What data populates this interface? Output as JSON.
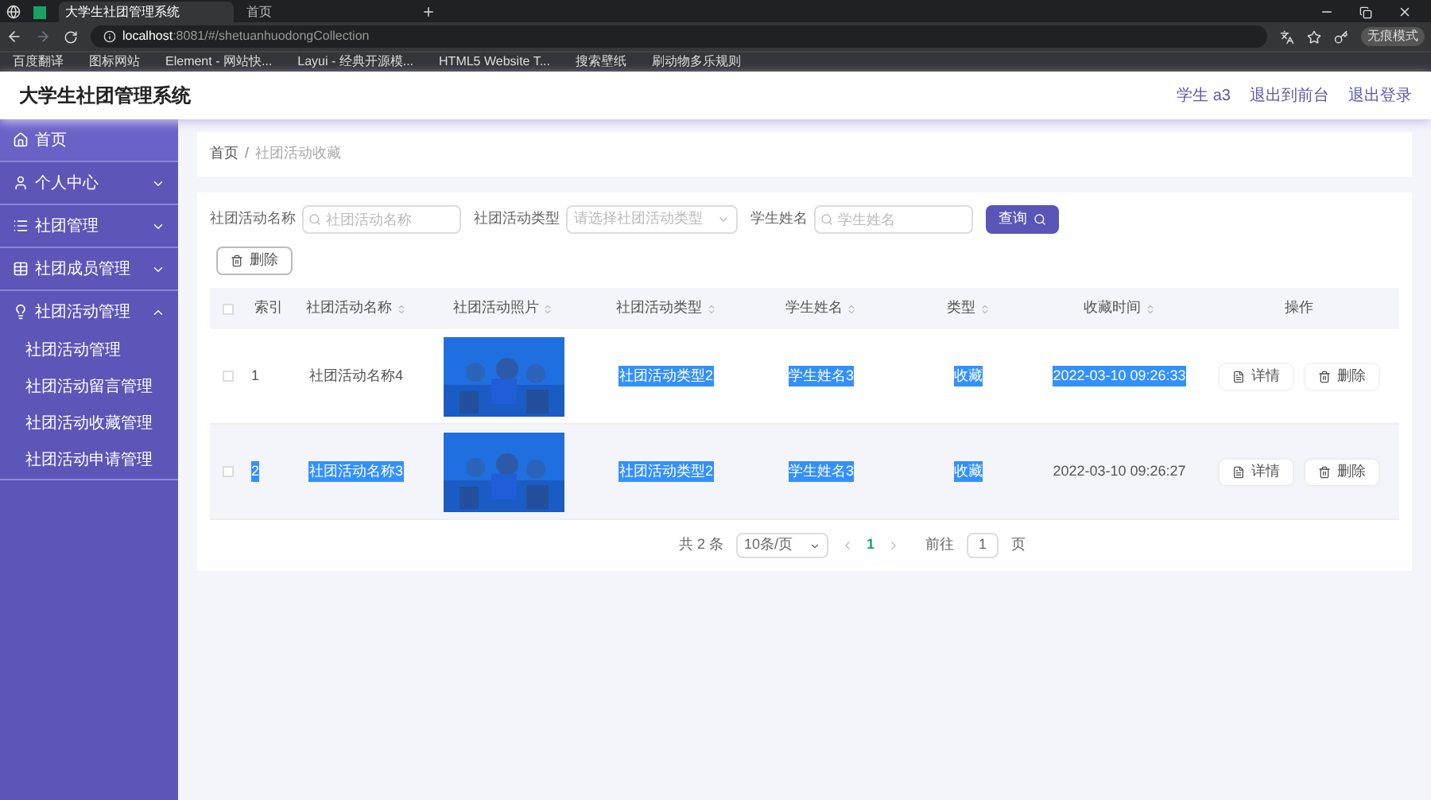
{
  "browser": {
    "tabs": [
      {
        "label": "大学生社团管理系统",
        "selected": true
      },
      {
        "label": "首页",
        "selected": false
      }
    ],
    "url": {
      "host": "localhost",
      "rest": ":8081/#/shetuanhuodongCollection"
    },
    "profile": "无痕模式",
    "bookmarks": [
      "百度翻译",
      "图标网站",
      "Element - 网站快...",
      "Layui - 经典开源模...",
      "HTML5 Website T...",
      "搜索壁纸",
      "刷动物多乐规则"
    ]
  },
  "header": {
    "title": "大学生社团管理系统",
    "links": [
      "学生 a3",
      "退出到前台",
      "退出登录"
    ]
  },
  "sidebar": {
    "items": [
      {
        "label": "首页",
        "kind": "home",
        "expandable": false,
        "expanded": false
      },
      {
        "label": "个人中心",
        "kind": "user",
        "expandable": true,
        "expanded": false
      },
      {
        "label": "社团管理",
        "kind": "list",
        "expandable": true,
        "expanded": false
      },
      {
        "label": "社团成员管理",
        "kind": "table",
        "expandable": true,
        "expanded": false
      },
      {
        "label": "社团活动管理",
        "kind": "bulb",
        "expandable": true,
        "expanded": true,
        "children": [
          {
            "label": "社团活动管理"
          },
          {
            "label": "社团活动留言管理"
          },
          {
            "label": "社团活动收藏管理"
          },
          {
            "label": "社团活动申请管理"
          }
        ]
      }
    ]
  },
  "breadcrumb": {
    "items": [
      "首页",
      "社团活动收藏"
    ],
    "separator": "/"
  },
  "filters": [
    {
      "kind": "input",
      "label": "社团活动名称",
      "placeholder": "社团活动名称"
    },
    {
      "kind": "select",
      "label": "社团活动类型",
      "placeholder": "请选择社团活动类型"
    },
    {
      "kind": "input",
      "label": "学生姓名",
      "placeholder": "学生姓名"
    }
  ],
  "search_button": "查询",
  "delete_button": "删除",
  "table": {
    "all_checked": false,
    "columns": [
      {
        "label": "索引",
        "sortable": false
      },
      {
        "label": "社团活动名称",
        "sortable": true
      },
      {
        "label": "社团活动照片",
        "sortable": true
      },
      {
        "label": "社团活动类型",
        "sortable": true
      },
      {
        "label": "学生姓名",
        "sortable": true
      },
      {
        "label": "类型",
        "sortable": true
      },
      {
        "label": "收藏时间",
        "sortable": true
      },
      {
        "label": "操作",
        "sortable": false
      }
    ],
    "rows": [
      {
        "checked": false,
        "cells": [
          {
            "text": "1",
            "highlighted": false
          },
          {
            "text": "社团活动名称4",
            "highlighted": false
          },
          {
            "kind": "picture"
          },
          {
            "text": "社团活动类型2",
            "highlighted": true
          },
          {
            "text": "学生姓名3",
            "highlighted": true
          },
          {
            "text": "收藏",
            "highlighted": true
          },
          {
            "text": "2022-03-10 09:26:33",
            "highlighted": true
          }
        ],
        "actions": [
          "详情",
          "删除"
        ]
      },
      {
        "checked": false,
        "cells": [
          {
            "text": "2",
            "highlighted": true
          },
          {
            "text": "社团活动名称3",
            "highlighted": true
          },
          {
            "kind": "picture"
          },
          {
            "text": "社团活动类型2",
            "highlighted": true
          },
          {
            "text": "学生姓名3",
            "highlighted": true
          },
          {
            "text": "收藏",
            "highlighted": true
          },
          {
            "text": "2022-03-10 09:26:27",
            "highlighted": false
          }
        ],
        "actions": [
          "详情",
          "删除"
        ]
      }
    ]
  },
  "pagination": {
    "total": "共 2 条",
    "page_size": "10条/页",
    "pages": [
      {
        "label": "1",
        "selected": true
      }
    ],
    "goto_label": "前往",
    "goto_value": "1",
    "goto_suffix": "页"
  }
}
